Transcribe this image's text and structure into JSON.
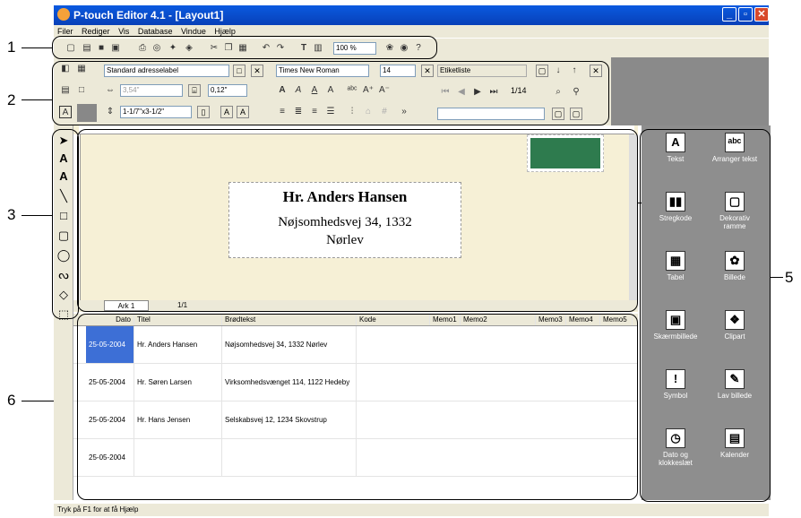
{
  "window": {
    "title": "P-touch Editor 4.1 - [Layout1]"
  },
  "menu": [
    "Filer",
    "Rediger",
    "Vis",
    "Database",
    "Vindue",
    "Hjælp"
  ],
  "toolbar1": {
    "zoom": "100 %"
  },
  "toolbar2": {
    "label_type": "Standard adresselabel",
    "width_value": "3,54\"",
    "margin_value": "0,12\"",
    "size_value": "1-1/7\"x3-1/2\"",
    "font_name": "Times New Roman",
    "font_size": "14",
    "list_title": "Etiketliste",
    "page_counter": "1/14"
  },
  "callouts": [
    "1",
    "2",
    "3",
    "4",
    "5",
    "6"
  ],
  "label": {
    "name": "Hr. Anders Hansen",
    "address_line1": "Nøjsomhedsvej 34, 1332",
    "address_line2": "Nørlev"
  },
  "tabs": {
    "sheet": "Ark 1",
    "counter": "1/1"
  },
  "database": {
    "columns": [
      "Dato",
      "Titel",
      "Brødtekst",
      "Kode",
      "Memo1",
      "Memo2",
      "Memo3",
      "Memo4",
      "Memo5"
    ],
    "rows": [
      {
        "dato": "25-05-2004",
        "titel": "Hr. Anders Hansen",
        "brodtekst": "Nøjsomhedsvej 34, 1332 Nørlev"
      },
      {
        "dato": "25-05-2004",
        "titel": "Hr. Søren Larsen",
        "brodtekst": "Virksomhedsvænget 114, 1122 Hedeby"
      },
      {
        "dato": "25-05-2004",
        "titel": "Hr. Hans Jensen",
        "brodtekst": "Selskabsvej 12, 1234 Skovstrup"
      },
      {
        "dato": "25-05-2004",
        "titel": "",
        "brodtekst": ""
      }
    ]
  },
  "objects": [
    {
      "label": "Tekst",
      "icon": "text-icon"
    },
    {
      "label": "Arranger tekst",
      "icon": "arrange-text-icon"
    },
    {
      "label": "Stregkode",
      "icon": "barcode-icon"
    },
    {
      "label": "Dekorativ ramme",
      "icon": "frame-icon"
    },
    {
      "label": "Tabel",
      "icon": "table-icon"
    },
    {
      "label": "Billede",
      "icon": "picture-icon"
    },
    {
      "label": "Skærmbillede",
      "icon": "screenshot-icon"
    },
    {
      "label": "Clipart",
      "icon": "clipart-icon"
    },
    {
      "label": "Symbol",
      "icon": "symbol-icon"
    },
    {
      "label": "Lav billede",
      "icon": "make-image-icon"
    },
    {
      "label": "Dato og klokkeslæt",
      "icon": "datetime-icon"
    },
    {
      "label": "Kalender",
      "icon": "calendar-icon"
    }
  ],
  "status": {
    "text": "Tryk på F1 for at få Hjælp"
  },
  "colors": {
    "titlebar": "#0a5ae0",
    "stamp": "#2e7b4e",
    "canvas": "#f6f0d6",
    "panel": "#8e8e8e",
    "selected_cell": "#3d6fd6"
  }
}
